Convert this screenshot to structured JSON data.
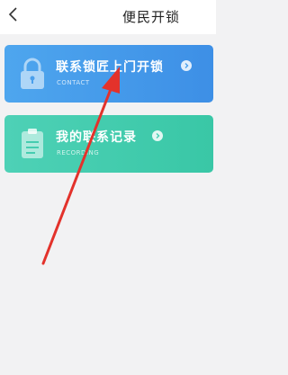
{
  "header": {
    "title": "便民开锁",
    "back_icon": "chevron-left-icon"
  },
  "cards": [
    {
      "title": "联系锁匠上门开锁",
      "subtitle": "CONTACT",
      "icon": "padlock-icon",
      "color": "#4a9fec"
    },
    {
      "title": "我的联系记录",
      "subtitle": "RECORDING",
      "icon": "clipboard-icon",
      "color": "#45cdb0"
    }
  ],
  "annotation": {
    "color": "#e3322b",
    "icon": "red-arrow-pointer"
  }
}
